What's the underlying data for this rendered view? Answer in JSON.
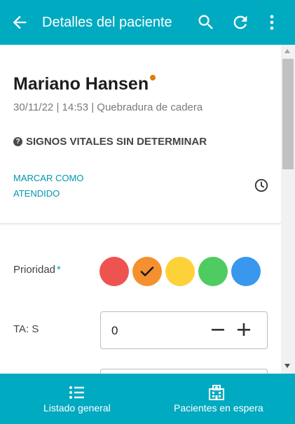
{
  "app_bar": {
    "title": "Detalles del paciente",
    "back_icon": "arrow-left-icon",
    "actions": [
      "search-icon",
      "refresh-icon",
      "more-vert-icon"
    ],
    "background": "#00aac1"
  },
  "patient": {
    "name": "Mariano Hansen",
    "status_color": "#e07b00",
    "meta": "30/11/22 | 14:53 | Quebradura de cadera",
    "vitals_status": "SIGNOS VITALES SIN DETERMINAR",
    "mark_attended": "MARCAR COMO ATENDIDO",
    "clock_icon": "clock-icon"
  },
  "form": {
    "priority": {
      "label": "Prioridad",
      "required_mark": "*",
      "options": [
        {
          "color": "#ef5350",
          "name": "red"
        },
        {
          "color": "#f5902e",
          "name": "orange",
          "selected": true
        },
        {
          "color": "#fdd13a",
          "name": "yellow"
        },
        {
          "color": "#4fcc61",
          "name": "green"
        },
        {
          "color": "#3a97ee",
          "name": "blue"
        }
      ]
    },
    "ta_s": {
      "label": "TA: S",
      "value": "0"
    }
  },
  "bottom_nav": {
    "items": [
      {
        "label": "Listado general",
        "icon": "list-icon"
      },
      {
        "label": "Pacientes en espera",
        "icon": "hospital-icon"
      }
    ]
  }
}
